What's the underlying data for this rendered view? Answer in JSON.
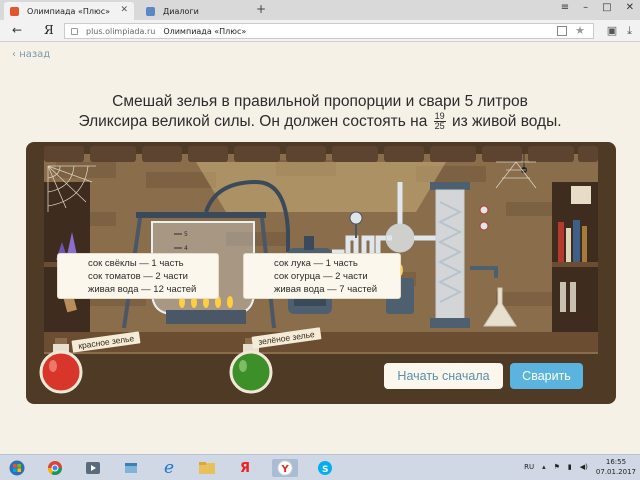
{
  "browser": {
    "tabs": [
      {
        "title": "Олимпиада «Плюс»",
        "active": true
      },
      {
        "title": "Диалоги",
        "active": false
      }
    ],
    "new_tab": "+",
    "window_controls": [
      "≡",
      "–",
      "□",
      "✕"
    ],
    "address": {
      "browser_letter": "Я",
      "host": "plus.olimpiada.ru",
      "page_title": "Олимпиада «Плюс»"
    }
  },
  "page": {
    "back_label": "назад",
    "task_line1": "Смешай зелья в правильной пропорции и свари 5 литров",
    "task_line2_prefix": "Эликсира великой силы. Он должен состоять на",
    "task_frac_num": "19",
    "task_frac_den": "25",
    "task_line2_suffix": "из живой воды.",
    "beaker_scale": [
      "5",
      "4",
      "3",
      "2",
      "1"
    ],
    "red_potion": {
      "label": "красное зелье",
      "ingredients": [
        "сок свёклы — 1 часть",
        "сок томатов — 2 части",
        "живая вода — 12 частей"
      ],
      "color": "#d9362b"
    },
    "green_potion": {
      "label": "зелёное зелье",
      "ingredients": [
        "сок лука — 1 часть",
        "сок огурца — 2 части",
        "живая вода — 7 частей"
      ],
      "color": "#3d8f2a"
    },
    "reset_button": "Начать сначала",
    "brew_button": "Сварить",
    "colors": {
      "accent": "#5ab4df",
      "frame": "#4f3a26",
      "wall": "#8a6d4a"
    }
  },
  "taskbar": {
    "apps": [
      "start-icon",
      "chrome-icon",
      "media-icon",
      "explorer-icon",
      "ie-icon",
      "folder-icon",
      "yandex-ya-icon",
      "yandex-browser-icon",
      "skype-icon"
    ],
    "lang": "RU",
    "time": "16:55",
    "date": "07.01.2017"
  }
}
